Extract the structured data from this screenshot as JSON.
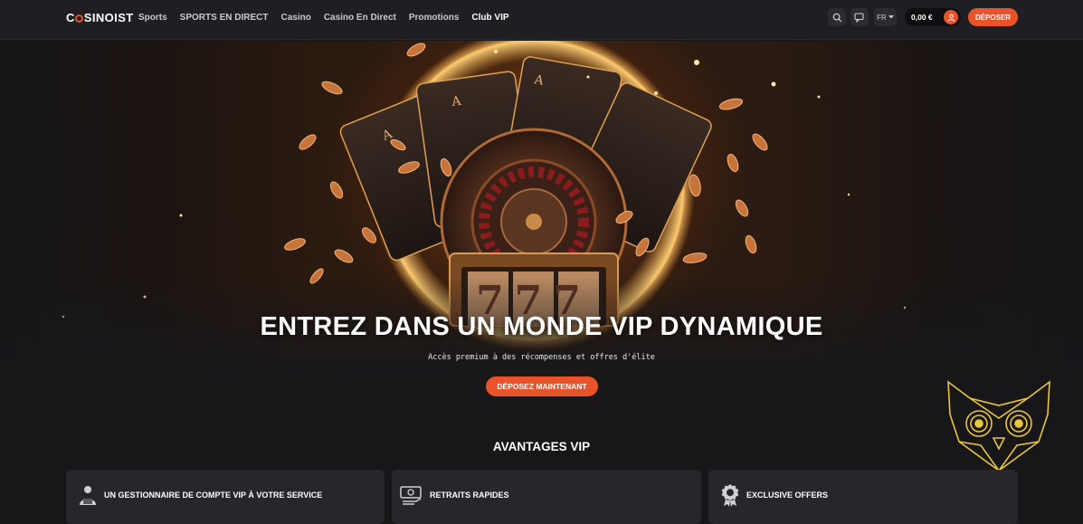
{
  "header": {
    "logo_text": "CASINOIST",
    "nav": [
      "Sports",
      "SPORTS EN DIRECT",
      "Casino",
      "Casino En Direct",
      "Promotions",
      "Club VIP"
    ],
    "active_nav": "Club VIP",
    "search_icon": "search-icon",
    "chat_icon": "chat-icon",
    "language": "FR",
    "balance": "0,00 €",
    "user_icon": "user-icon",
    "deposit_label": "DÉPOSER"
  },
  "hero": {
    "title": "ENTREZ DANS UN MONDE VIP DYNAMIQUE",
    "subtitle": "Accès premium à des récompenses et offres d'élite",
    "cta_label": "DÉPOSEZ MAINTENANT",
    "slot_reels": "777"
  },
  "benefits": {
    "title": "AVANTAGES VIP",
    "cards": [
      {
        "label": "UN GESTIONNAIRE DE COMPTE VIP À VOTRE SERVICE",
        "icon": "account-manager-icon"
      },
      {
        "label": "RETRAITS RAPIDES",
        "icon": "cash-withdrawal-icon"
      },
      {
        "label": "EXCLUSIVE OFFERS",
        "icon": "award-badge-icon"
      }
    ]
  },
  "colors": {
    "accent": "#e8532a",
    "background": "#17171a",
    "card": "#26262b",
    "owl": "#e9c63a"
  }
}
